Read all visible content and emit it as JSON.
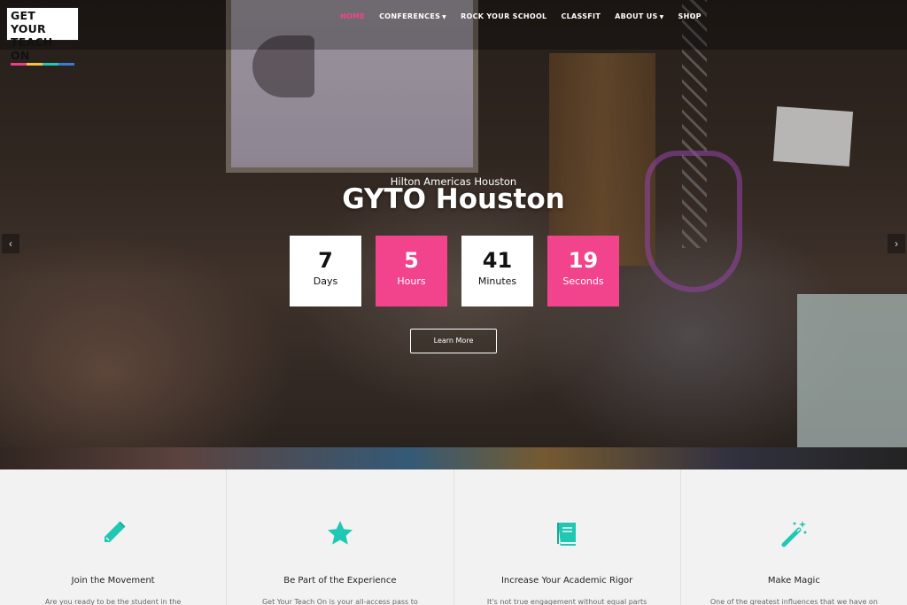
{
  "logo": {
    "line1": "GET YOUR",
    "line2": "TEACH ON"
  },
  "nav": {
    "items": [
      {
        "label": "HOME",
        "active": true
      },
      {
        "label": "CONFERENCES",
        "dropdown": true
      },
      {
        "label": "ROCK YOUR SCHOOL"
      },
      {
        "label": "CLASSFIT"
      },
      {
        "label": "ABOUT US",
        "dropdown": true
      },
      {
        "label": "SHOP"
      }
    ]
  },
  "hero": {
    "venue": "Hilton Americas Houston",
    "title": "GYTO Houston",
    "countdown": [
      {
        "value": "7",
        "label": "Days"
      },
      {
        "value": "5",
        "label": "Hours"
      },
      {
        "value": "41",
        "label": "Minutes"
      },
      {
        "value": "19",
        "label": "Seconds"
      }
    ],
    "button": "Learn More",
    "prev_arrow": "‹",
    "next_arrow": "›"
  },
  "features": [
    {
      "icon": "pencil-icon",
      "title": "Join the Movement",
      "text": "Are you ready to be the student in the"
    },
    {
      "icon": "star-icon",
      "title": "Be Part of the Experience",
      "text": "Get Your Teach On is your all-access pass to"
    },
    {
      "icon": "book-icon",
      "title": "Increase Your Academic Rigor",
      "text": "It's not true engagement without equal parts"
    },
    {
      "icon": "magic-wand-icon",
      "title": "Make Magic",
      "text": "One of the greatest influences that we have on"
    }
  ],
  "colors": {
    "accent_pink": "#f2438d",
    "accent_teal": "#1ec8b2"
  }
}
